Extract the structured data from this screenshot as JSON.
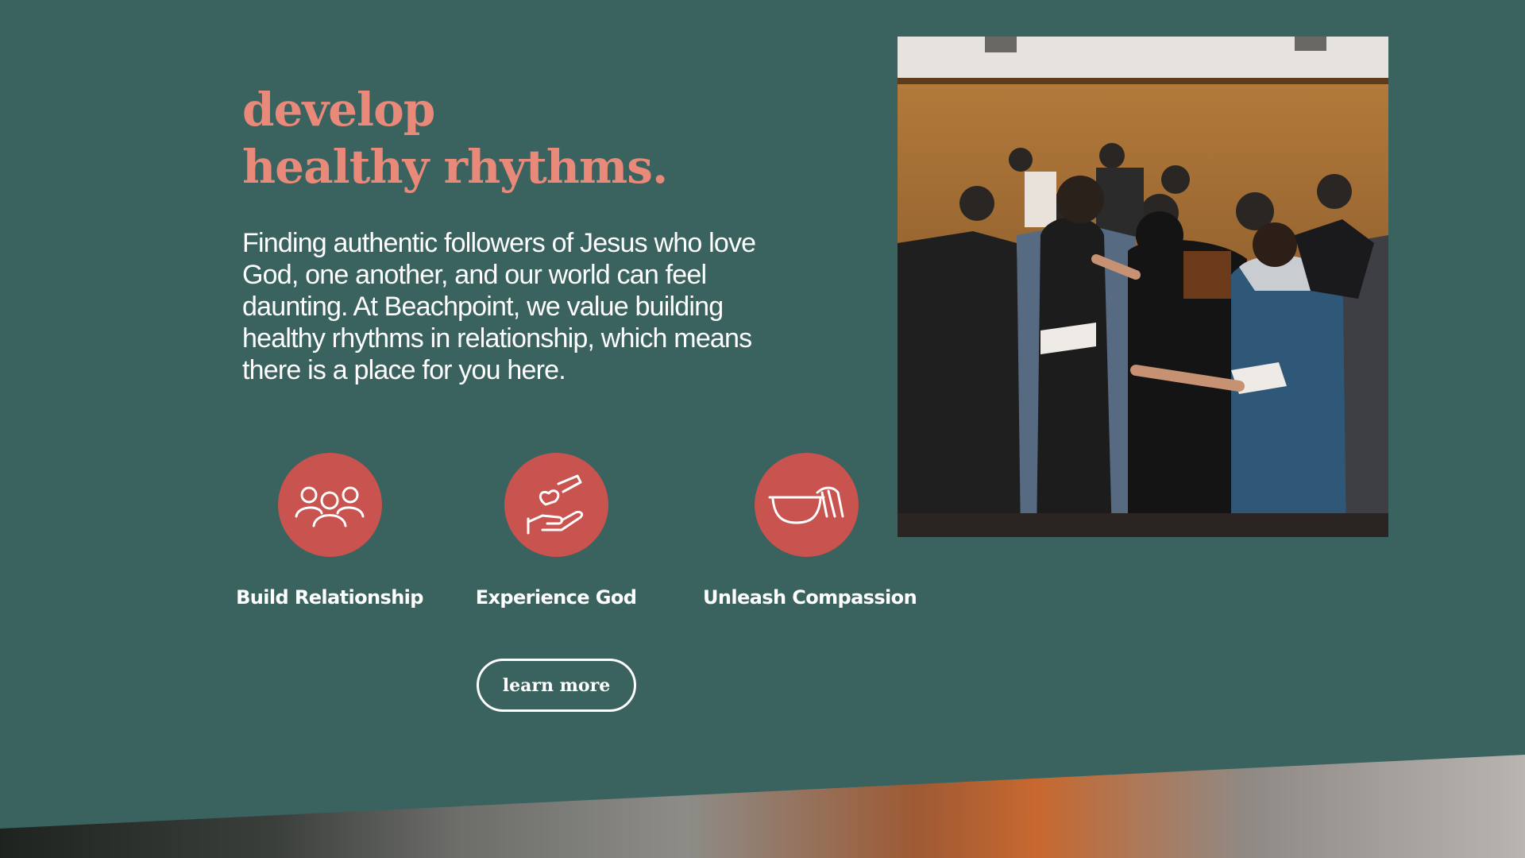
{
  "heading": {
    "line1": "develop",
    "line2": "healthy rhythms."
  },
  "intro": "Finding authentic followers of Jesus who love God, one another, and our world can feel daunting. At Beachpoint, we value building healthy rhythms in relationship, which means there is a place for you here.",
  "pillars": [
    {
      "label": "Build Relationship",
      "icon": "people-group-icon"
    },
    {
      "label": "Experience God",
      "icon": "hands-heart-icon"
    },
    {
      "label": "Unleash Compassion",
      "icon": "basin-towel-icon"
    }
  ],
  "cta": {
    "label": "learn more"
  },
  "photo": {
    "subject": "worship-group-photo"
  },
  "colors": {
    "background": "#3a625e",
    "heading": "#e8897a",
    "icon_circle": "#c8534f",
    "text": "#ffffff"
  }
}
